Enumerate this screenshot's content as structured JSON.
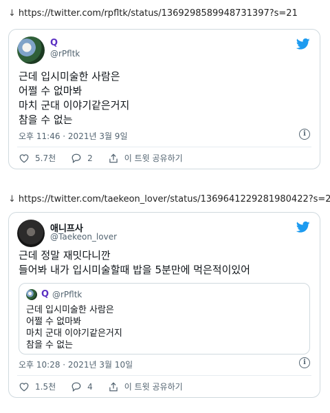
{
  "tweet1": {
    "url": "https://twitter.com/rpfltk/status/1369298589948731397?s=21",
    "name": "Q",
    "handle": "@rPfltk",
    "text": "근데 입시미술한 사람은\n어쩔 수 없마봐\n마치 군대 이야기같은거지\n참을 수 없는",
    "timestamp": "오후 11:46 · 2021년 3월 9일",
    "likes": "5.7천",
    "replies": "2",
    "share_label": "이 트윗 공유하기"
  },
  "tweet2": {
    "url": "https://twitter.com/taekeon_lover/status/1369641229281980422?s=21",
    "name": "애니프사",
    "handle": "@Taekeon_lover",
    "text": "근데 정말 재밋다니깐\n들어봐 내가 입시미술할때 밥을 5분만에 먹은적이있어",
    "quote": {
      "name": "Q",
      "handle": "@rPfltk",
      "text": "근데 입시미술한 사람은\n어쩔 수 없마봐\n마치 군대 이야기같은거지\n참을 수 없는"
    },
    "timestamp": "오후 10:28 · 2021년 3월 10일",
    "likes": "1.5천",
    "replies": "4",
    "share_label": "이 트윗 공유하기"
  },
  "icons": {
    "download": "down-arrow-icon",
    "brand": "twitter-bird-icon",
    "like": "heart-icon",
    "reply": "comment-icon",
    "share": "share-icon",
    "info": "info-icon"
  },
  "colors": {
    "twitter_blue": "#1d9bf0",
    "name_purple": "#5a2fc2",
    "secondary_text": "#536471",
    "border": "#cfd9de"
  }
}
